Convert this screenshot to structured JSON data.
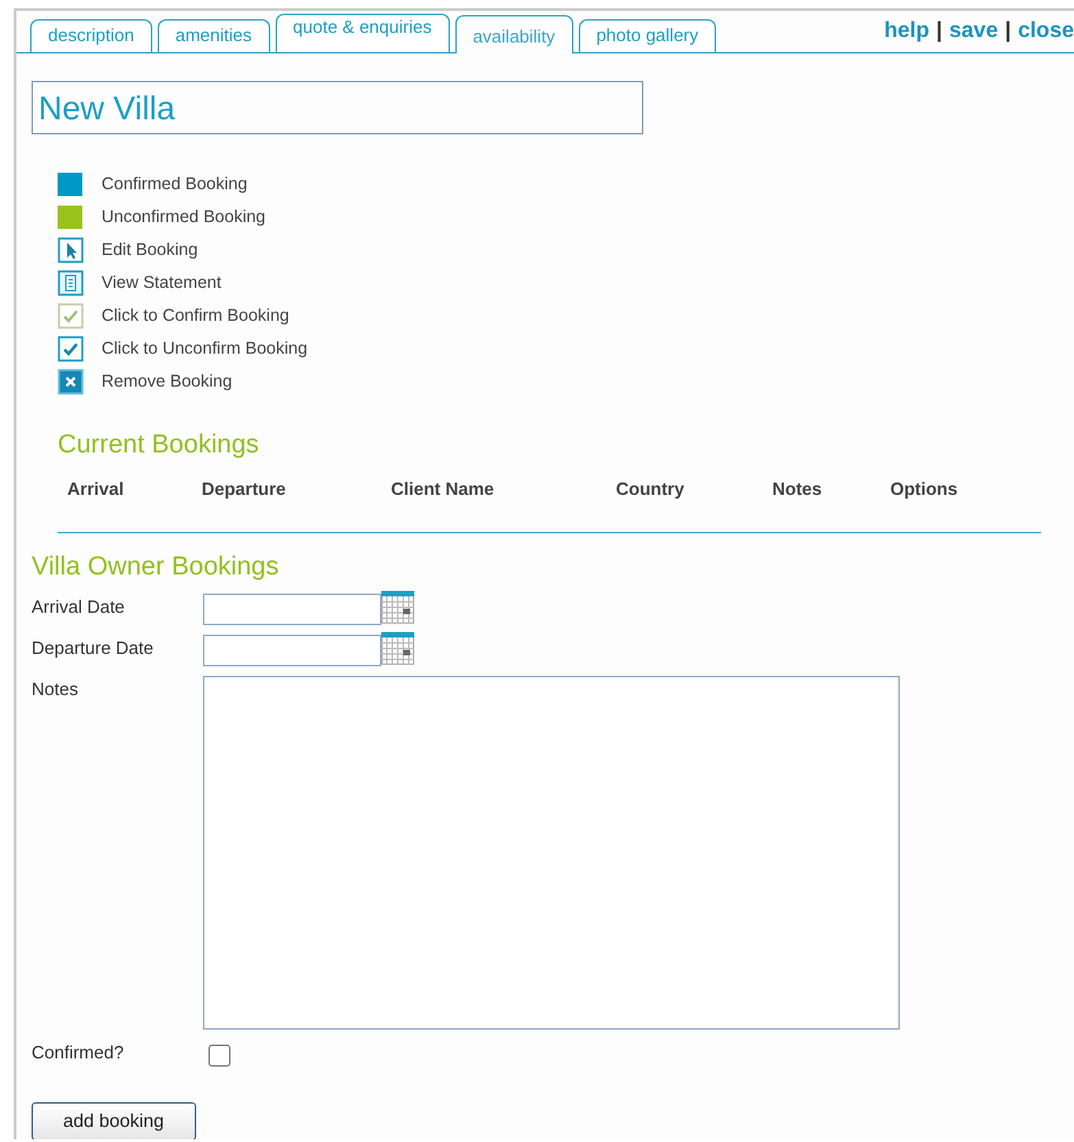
{
  "tabs": [
    {
      "label": "description",
      "selected": false
    },
    {
      "label": "amenities",
      "selected": false
    },
    {
      "label": "quote & enquiries",
      "selected": false
    },
    {
      "label": "availability",
      "selected": true
    },
    {
      "label": "photo gallery",
      "selected": false
    }
  ],
  "actions": [
    "help",
    "save",
    "close"
  ],
  "action_separator": "|",
  "villa_name": "New Villa",
  "legend": [
    {
      "kind": "swatch",
      "color": "#0099c6",
      "label": "Confirmed Booking"
    },
    {
      "kind": "swatch",
      "color": "#99c31c",
      "label": "Unconfirmed Booking"
    },
    {
      "kind": "edit",
      "label": "Edit Booking"
    },
    {
      "kind": "statement",
      "label": "View  Statement"
    },
    {
      "kind": "confirm",
      "label": "Click to Confirm Booking"
    },
    {
      "kind": "unconfirm",
      "label": "Click to Unconfirm Booking"
    },
    {
      "kind": "remove",
      "label": "Remove Booking"
    }
  ],
  "current_bookings": {
    "title": "Current Bookings",
    "columns": [
      "Arrival",
      "Departure",
      "Client Name",
      "Country",
      "Notes",
      "Options"
    ]
  },
  "owner_bookings": {
    "title": "Villa Owner Bookings",
    "fields": [
      {
        "kind": "date",
        "label": "Arrival  Date"
      },
      {
        "kind": "date",
        "label": "Departure Date"
      },
      {
        "kind": "textarea",
        "label": "Notes"
      },
      {
        "kind": "checkbox",
        "label": "Confirmed?",
        "checked": false
      }
    ],
    "button": "add booking"
  }
}
